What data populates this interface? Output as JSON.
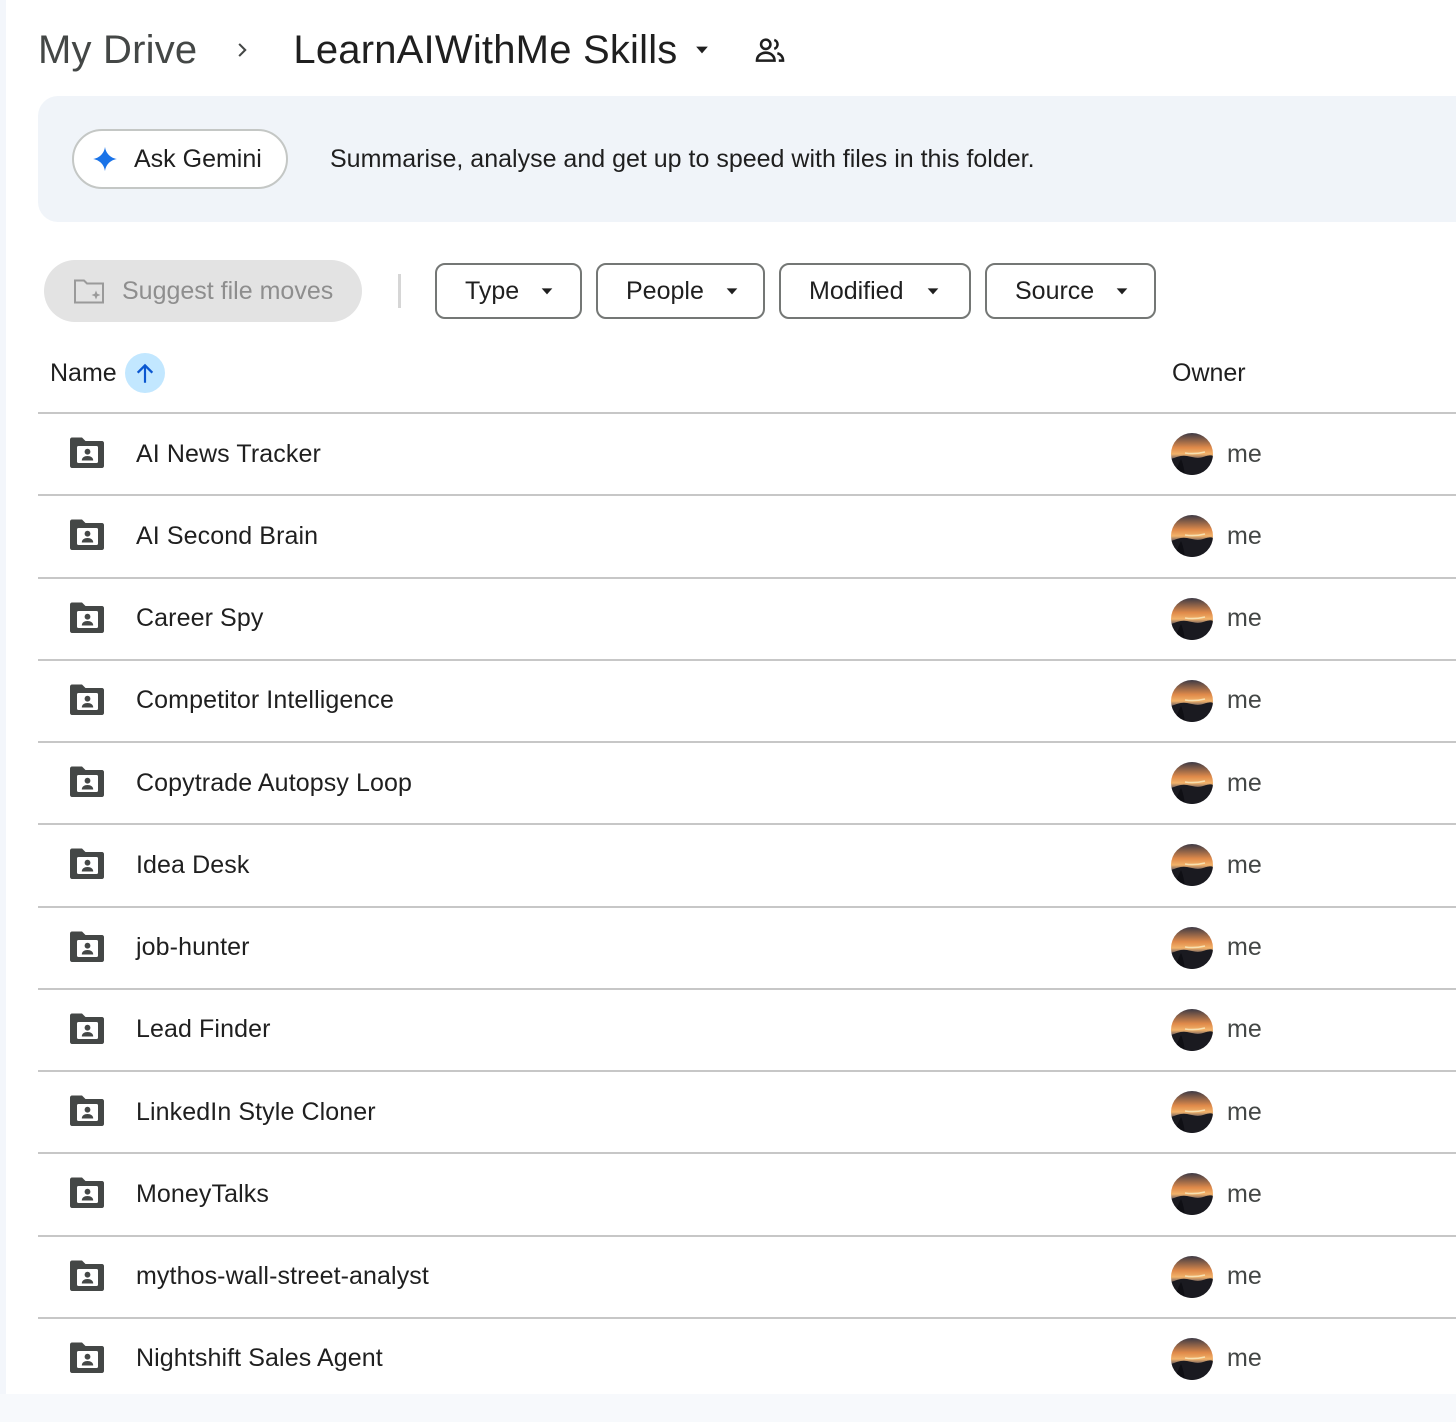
{
  "breadcrumb": {
    "root": "My Drive",
    "current": "LearnAIWithMe Skills"
  },
  "gemini": {
    "button_label": "Ask Gemini",
    "description": "Summarise, analyse and get up to speed with files in this folder."
  },
  "toolbar": {
    "suggest_label": "Suggest file moves",
    "filters": [
      "Type",
      "People",
      "Modified",
      "Source"
    ]
  },
  "table": {
    "columns": {
      "name": "Name",
      "owner": "Owner"
    },
    "sort_direction": "ascending",
    "rows": [
      {
        "name": "AI News Tracker",
        "owner": "me"
      },
      {
        "name": "AI Second Brain",
        "owner": "me"
      },
      {
        "name": "Career Spy",
        "owner": "me"
      },
      {
        "name": "Competitor Intelligence",
        "owner": "me"
      },
      {
        "name": "Copytrade Autopsy Loop",
        "owner": "me"
      },
      {
        "name": "Idea Desk",
        "owner": "me"
      },
      {
        "name": "job-hunter",
        "owner": "me"
      },
      {
        "name": "Lead Finder",
        "owner": "me"
      },
      {
        "name": "LinkedIn Style Cloner",
        "owner": "me"
      },
      {
        "name": "MoneyTalks",
        "owner": "me"
      },
      {
        "name": "mythos-wall-street-analyst",
        "owner": "me"
      },
      {
        "name": "Nightshift Sales Agent",
        "owner": "me"
      }
    ]
  },
  "icons": {
    "breadcrumb_separator": "chevron-right-icon",
    "folder_menu": "caret-down-icon",
    "shared": "people-icon",
    "gemini": "gemini-spark-icon",
    "suggest": "folder-sparkle-icon",
    "sort": "arrow-up-icon",
    "row": "shared-folder-icon"
  },
  "colors": {
    "banner_bg": "#f0f4f9",
    "sort_bg": "#c2e7ff",
    "sort_arrow": "#0b57d0",
    "gemini_blue": "#1a73e8",
    "folder_icon": "#444746",
    "divider": "#c7c7c7"
  }
}
